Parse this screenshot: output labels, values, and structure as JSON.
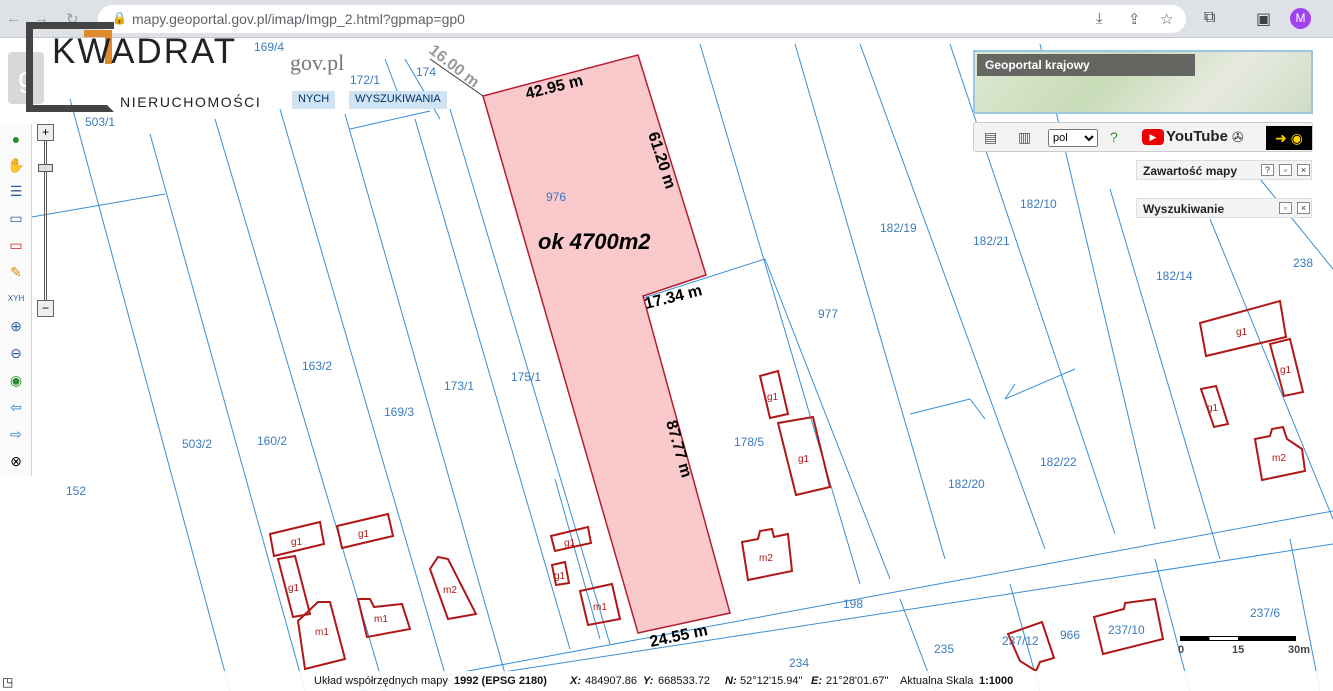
{
  "browser": {
    "url": "mapy.geoportal.gov.pl/imap/Imgp_2.html?gpmap=gp0",
    "profile_initial": "M"
  },
  "watermark": {
    "title": "KWADRAT",
    "subtitle": "NIERUCHOMOŚCI"
  },
  "brand": "gov.pl",
  "menu": {
    "data_label": "NYCH",
    "search_label": "WYSZUKIWANIA"
  },
  "overview": {
    "title": "Geoportal krajowy"
  },
  "toolbar": {
    "language": "pol",
    "youtube_label": "YouTube"
  },
  "panels": {
    "contents_title": "Zawartość mapy",
    "search_title": "Wyszukiwanie"
  },
  "map": {
    "area_label": "ok 4700m2",
    "dimensions": [
      "42.95 m",
      "61.20 m",
      "17.34 m",
      "87.77 m",
      "24.55 m",
      "16.00 m"
    ],
    "plots": [
      "976",
      "977",
      "175/1",
      "178/5",
      "173/1",
      "169/3",
      "163/2",
      "160/2",
      "503/2",
      "503/1",
      "152",
      "182/19",
      "182/21",
      "182/10",
      "182/14",
      "238",
      "182/20",
      "182/22",
      "198",
      "234",
      "235",
      "237/12",
      "966",
      "237/10",
      "237/6",
      "169/4",
      "172/1",
      "174"
    ],
    "buildings": [
      "g1",
      "m1",
      "m2"
    ]
  },
  "status": {
    "coord_system_label": "Układ współrzędnych mapy",
    "coord_system_value": "1992 (EPSG 2180)",
    "x_label": "X:",
    "x_value": "484907.86",
    "y_label": "Y:",
    "y_value": "668533.72",
    "n_label": "N:",
    "n_value": "52°12'15.94\"",
    "e_label": "E:",
    "e_value": "21°28'01.67\"",
    "scale_label": "Aktualna Skala",
    "scale_value": "1:1000"
  },
  "scalebar": {
    "ticks": [
      "0",
      "15",
      "30m"
    ]
  },
  "colors": {
    "parcel_fill": "#f9c9cc",
    "parcel_line": "#b51d2e",
    "plot_line": "#3a8fd6",
    "building_line": "#b01818"
  }
}
